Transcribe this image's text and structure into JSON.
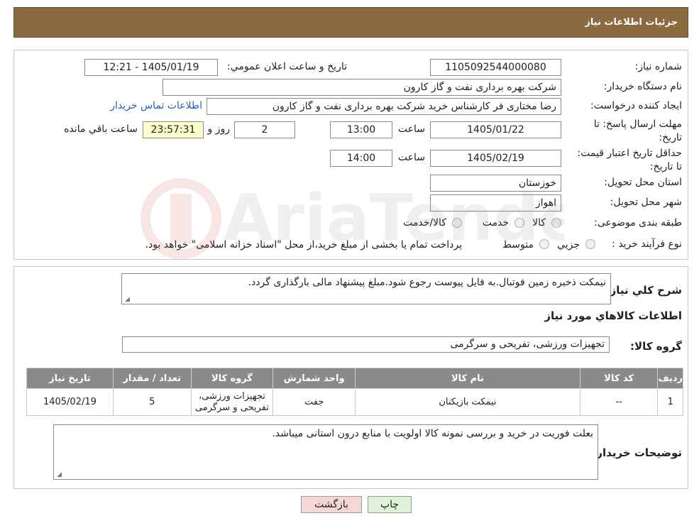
{
  "header": {
    "title": "جزئیات اطلاعات نیاز"
  },
  "form": {
    "need_number_label": "شماره نیاز:",
    "need_number": "1105092544000080",
    "announce_label": "تاریخ و ساعت اعلان عمومي:",
    "announce_value": "1405/01/19 - 12:21",
    "buyer_org_label": "نام دستگاه خریدار:",
    "buyer_org": "شرکت بهره برداری نفت و گاز کارون",
    "creator_label": "ایجاد کننده درخواست:",
    "creator": "رضا مختاری فر کارشناس خرید شرکت بهره برداری نفت و گاز کارون",
    "contact_link": "اطلاعات تماس خریدار",
    "deadline_label": "مهلت ارسال پاسخ: تا تاریخ:",
    "deadline_date": "1405/01/22",
    "time_label": "ساعت",
    "deadline_time": "13:00",
    "days": "2",
    "days_label": "روز و",
    "remaining": "23:57:31",
    "remaining_label": "ساعت باقي مانده",
    "validity_label": "حداقل تاریخ اعتبار قیمت: تا تاریخ:",
    "validity_date": "1405/02/19",
    "validity_time": "14:00",
    "province_label": "استان محل تحویل:",
    "province": "خوزستان",
    "city_label": "شهر محل تحویل:",
    "city": "اهواز",
    "category_label": "طبقه بندی موضوعی:",
    "category_options": [
      "کالا",
      "خدمت",
      "کالا/خدمت"
    ],
    "process_label": "نوع فرآیند خرید :",
    "process_options": [
      "جزیي",
      "متوسط"
    ],
    "process_note": "پرداخت تمام یا بخشی از مبلغ خرید،از محل \"اسناد خزانه اسلامی\" خواهد بود."
  },
  "details": {
    "desc_label": "شرح کلي نیاز:",
    "desc": "نیمکت ذخیره زمین فوتبال.به فایل پیوست رجوع شود.مبلغ پیشنهاد مالی بارگذاری گردد.",
    "goods_info_title": "اطلاعات کالاهاي مورد نیاز",
    "goods_group_label": "گروه کالا:",
    "goods_group": "تجهیزات ورزشی، تفریحی و سرگرمی",
    "table": {
      "headers": [
        "ردیف",
        "کد کالا",
        "نام کالا",
        "واحد شمارش",
        "گروه کالا",
        "تعداد / مقدار",
        "تاریخ نیاز"
      ],
      "rows": [
        [
          "1",
          "--",
          "نیمکت بازیکنان",
          "جفت",
          "تجهیزات ورزشی، تفریحی و سرگرمی",
          "5",
          "1405/02/19"
        ]
      ]
    },
    "buyer_notes_label": "توضیحات خریدار:",
    "buyer_notes": "بعلت فوریت در خرید و بررسی نمونه کالا اولویت با منابع درون استانی میباشد."
  },
  "buttons": {
    "print": "چاپ",
    "back": "بازگشت"
  },
  "colors": {
    "header_bg": "#8c6a3f",
    "table_header_bg": "#8a8a8a",
    "back_bg": "#f7d6d6",
    "print_bg": "#ddf2d6"
  }
}
